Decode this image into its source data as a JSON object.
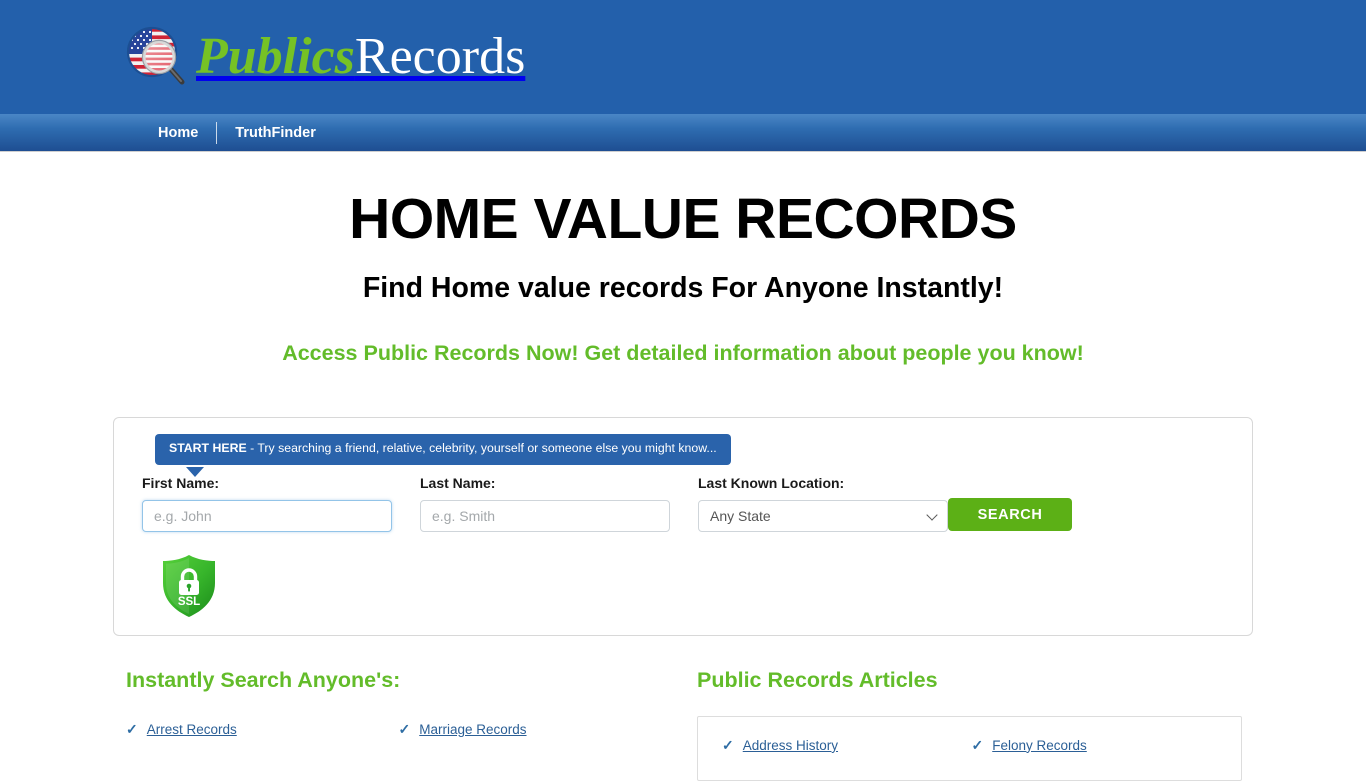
{
  "brand": {
    "name_part1": "Publics",
    "name_part2": "Records",
    "logo_icon": "us-flag-magnifier-icon",
    "header_color": "#2360ab",
    "accent_green": "#63bc2a",
    "link_blue": "#2b5f96"
  },
  "nav": {
    "items": [
      {
        "label": "Home"
      },
      {
        "label": "TruthFinder"
      }
    ]
  },
  "hero": {
    "title": "HOME VALUE RECORDS",
    "subtitle": "Find Home value records For Anyone Instantly!",
    "tagline": "Access Public Records Now! Get detailed information about people you know!"
  },
  "search": {
    "tip_bold": "START HERE",
    "tip_rest": " - Try searching a friend, relative, celebrity, yourself or someone else you might know...",
    "first_name": {
      "label": "First Name:",
      "placeholder": "e.g. John",
      "value": ""
    },
    "last_name": {
      "label": "Last Name:",
      "placeholder": "e.g. Smith",
      "value": ""
    },
    "location": {
      "label": "Last Known Location:",
      "selected": "Any State",
      "options": [
        "Any State"
      ]
    },
    "submit_label": "SEARCH",
    "ssl_badge": "SSL",
    "submit_color": "#5cb016"
  },
  "sections": {
    "left": {
      "heading": "Instantly Search Anyone's:",
      "links": [
        {
          "label": "Arrest Records"
        },
        {
          "label": "Marriage Records"
        }
      ]
    },
    "right": {
      "heading": "Public Records Articles",
      "links": [
        {
          "label": "Address History"
        },
        {
          "label": "Felony Records"
        }
      ]
    }
  }
}
